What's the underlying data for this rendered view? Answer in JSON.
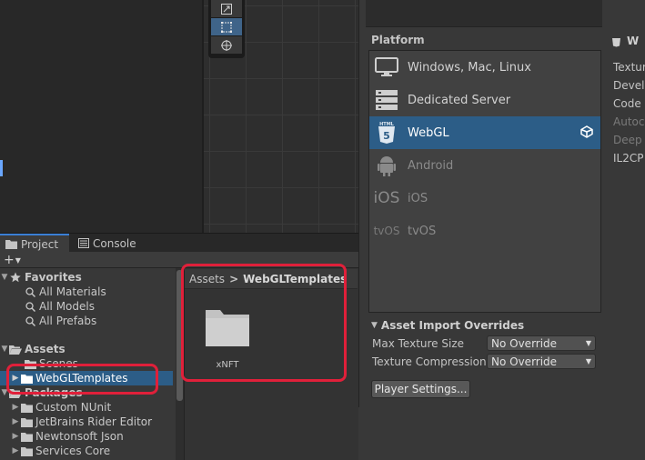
{
  "project_window": {
    "tabs": [
      {
        "label": "Project",
        "icon": "folder-icon",
        "active": true
      },
      {
        "label": "Console",
        "icon": "console-icon",
        "active": false
      }
    ],
    "create_button": "+",
    "tree": {
      "favorites_label": "Favorites",
      "favorites": [
        "All Materials",
        "All Models",
        "All Prefabs"
      ],
      "assets_label": "Assets",
      "assets_children": [
        "Scenes",
        "WebGLTemplates"
      ],
      "packages_label": "Packages",
      "packages_children": [
        "Custom NUnit",
        "JetBrains Rider Editor",
        "Newtonsoft Json",
        "Services Core"
      ]
    },
    "breadcrumb": {
      "root": "Assets",
      "separator": ">",
      "current": "WebGLTemplates"
    },
    "assets_grid": [
      {
        "name": "xNFT",
        "icon": "folder-icon"
      }
    ]
  },
  "build_settings": {
    "platform_header": "Platform",
    "platforms": [
      {
        "label": "Windows, Mac, Linux",
        "icon": "monitor-icon",
        "enabled": true
      },
      {
        "label": "Dedicated Server",
        "icon": "server-icon",
        "enabled": true
      },
      {
        "label": "WebGL",
        "icon": "html5-icon",
        "enabled": true,
        "selected": true
      },
      {
        "label": "Android",
        "icon": "android-icon",
        "enabled": false
      },
      {
        "label": "iOS",
        "icon": "ios-text-icon",
        "icon_text": "iOS",
        "enabled": false
      },
      {
        "label": "tvOS",
        "icon": "tvos-text-icon",
        "icon_text": "tvOS",
        "enabled": false
      }
    ],
    "right_column": {
      "header": "W",
      "lines": [
        "Textur",
        "Develo",
        "Code",
        "Autoco",
        "Deep",
        "IL2CP"
      ]
    },
    "asset_import_overrides": {
      "header": "Asset Import Overrides",
      "rows": [
        {
          "label": "Max Texture Size",
          "value": "No Override"
        },
        {
          "label": "Texture Compression",
          "value": "No Override"
        }
      ]
    },
    "player_settings_button": "Player Settings..."
  },
  "colors": {
    "selection": "#2c5d87",
    "highlight_annotation": "#e0203a",
    "panel_bg": "#383838"
  }
}
